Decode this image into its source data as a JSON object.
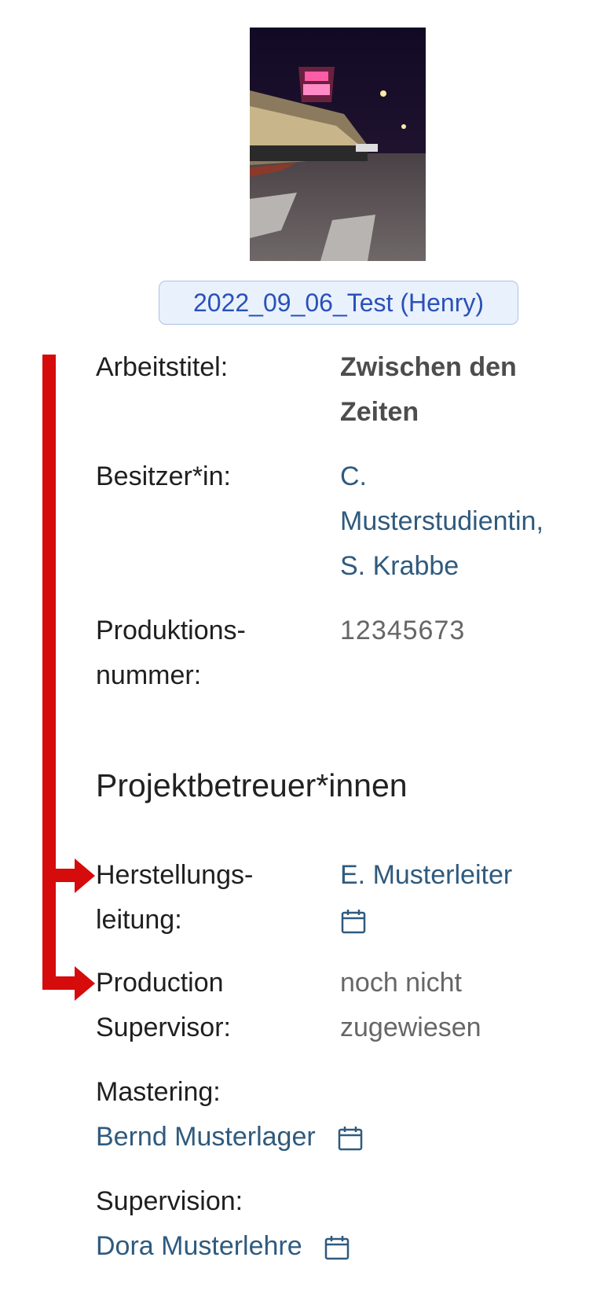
{
  "project": {
    "tag_label": "2022_09_06_Test (Henry)"
  },
  "details": {
    "working_title_label": "Arbeitstitel:",
    "working_title_line1": "Zwischen den",
    "working_title_line2": "Zeiten",
    "owner_label": "Besitzer*in:",
    "owner_line1": "C.",
    "owner_line2": "Musterstudientin,",
    "owner_line3": "S. Krabbe",
    "production_number_label_line1": "Produktions-",
    "production_number_label_line2": "nummer:",
    "production_number": "12345673"
  },
  "supervisors": {
    "section_title": "Projektbetreuer*innen",
    "production_manager_label_line1": "Herstellungs-",
    "production_manager_label_line2": "leitung:",
    "production_manager_value": "E. Musterleiter",
    "production_supervisor_label_line1": "Production",
    "production_supervisor_label_line2": "Supervisor:",
    "production_supervisor_value_line1": "noch nicht",
    "production_supervisor_value_line2": "zugewiesen",
    "mastering_label": "Mastering:",
    "mastering_value": "Bernd Musterlager",
    "supervision_label": "Supervision:",
    "supervision_value": "Dora Musterlehre"
  },
  "icons": {
    "calendar": "calendar-icon",
    "annotation_arrow": "arrow-right-icon"
  },
  "colors": {
    "annotation": "#d60b0b",
    "link": "#2f5a7e",
    "tag_text": "#2a51b8",
    "tag_bg": "#e9f1fc"
  }
}
